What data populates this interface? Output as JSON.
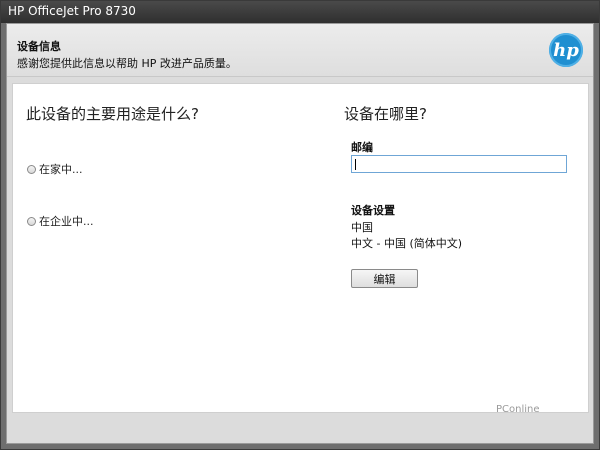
{
  "window": {
    "title": "HP OfficeJet Pro 8730"
  },
  "header": {
    "title": "设备信息",
    "subtitle": "感谢您提供此信息以帮助 HP 改进产品质量。",
    "logo_text": "hp",
    "logo_color": "#1f8fd1"
  },
  "left": {
    "question": "此设备的主要用途是什么?",
    "options": [
      "在家中...",
      "在企业中..."
    ]
  },
  "right": {
    "question": "设备在哪里?",
    "zip_label": "邮编",
    "zip_value": "",
    "settings_label": "设备设置",
    "country": "中国",
    "language": "中文 - 中国 (简体中文)",
    "edit_label": "编辑"
  },
  "watermark": "PConline"
}
